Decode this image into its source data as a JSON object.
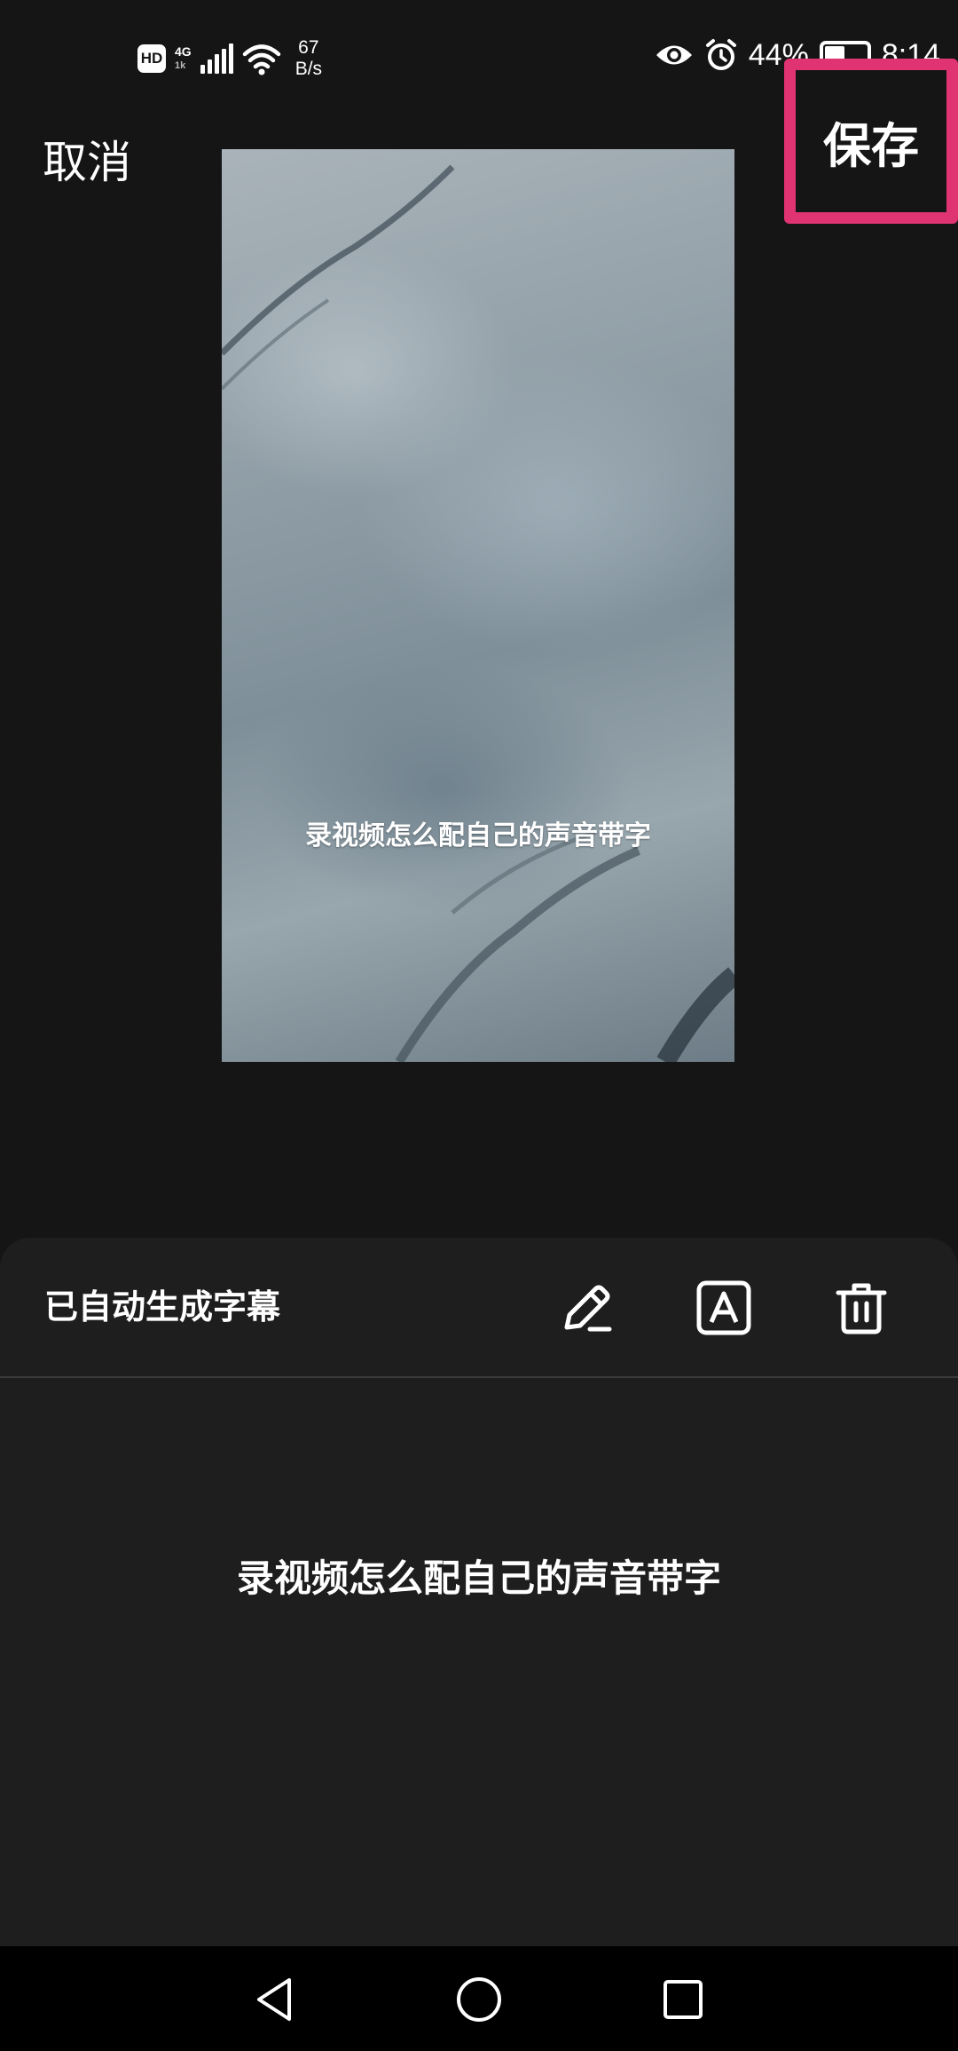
{
  "status_bar": {
    "hd_label": "HD",
    "network_type": "4G",
    "network_sub": "1k",
    "net_speed_value": "67",
    "net_speed_unit": "B/s",
    "battery_percent": "44%",
    "battery_level": 0.44,
    "time": "8:14",
    "icons": [
      "signal-icon",
      "wifi-icon",
      "eye-icon",
      "alarm-icon",
      "battery-icon"
    ]
  },
  "toolbar": {
    "cancel_label": "取消",
    "save_label": "保存",
    "highlight_color": "#e03372"
  },
  "video": {
    "caption": "录视频怎么配自己的声音带字"
  },
  "subtitle_panel": {
    "title": "已自动生成字幕",
    "tools": [
      "edit-pencil-icon",
      "text-style-icon",
      "delete-trash-icon"
    ],
    "subtitle_text": "录视频怎么配自己的声音带字"
  },
  "nav_bar": {
    "buttons": [
      "back-icon",
      "home-icon",
      "recents-icon"
    ]
  },
  "colors": {
    "background": "#151515",
    "panel": "#1e1e1e",
    "nav": "#000000",
    "text": "#ffffff"
  }
}
